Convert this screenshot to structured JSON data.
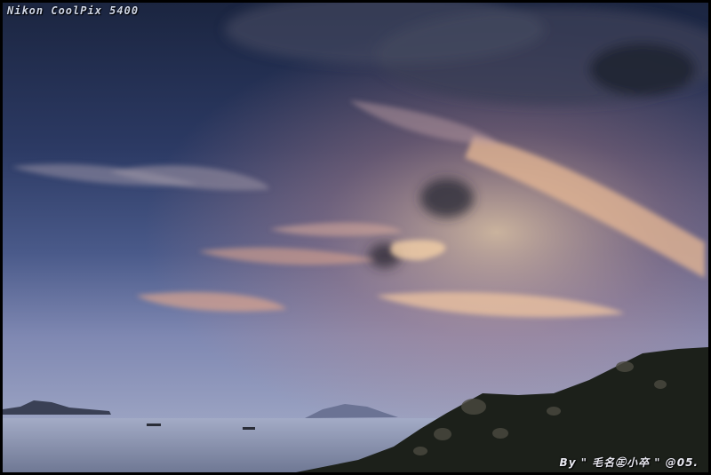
{
  "image": {
    "camera_label": "Nikon CoolPix 5400",
    "signature": "By \" 毛名㊣小卒 \" @05.",
    "scene": "sunset sky over sea with rocky hillside",
    "colors": {
      "sky_top": "#1d2946",
      "sky_mid": "#3a4a78",
      "sky_horizon": "#8a93b8",
      "glow": "#f2c49a",
      "sea": "#8f99b3",
      "hill": "#1b1f18"
    }
  }
}
